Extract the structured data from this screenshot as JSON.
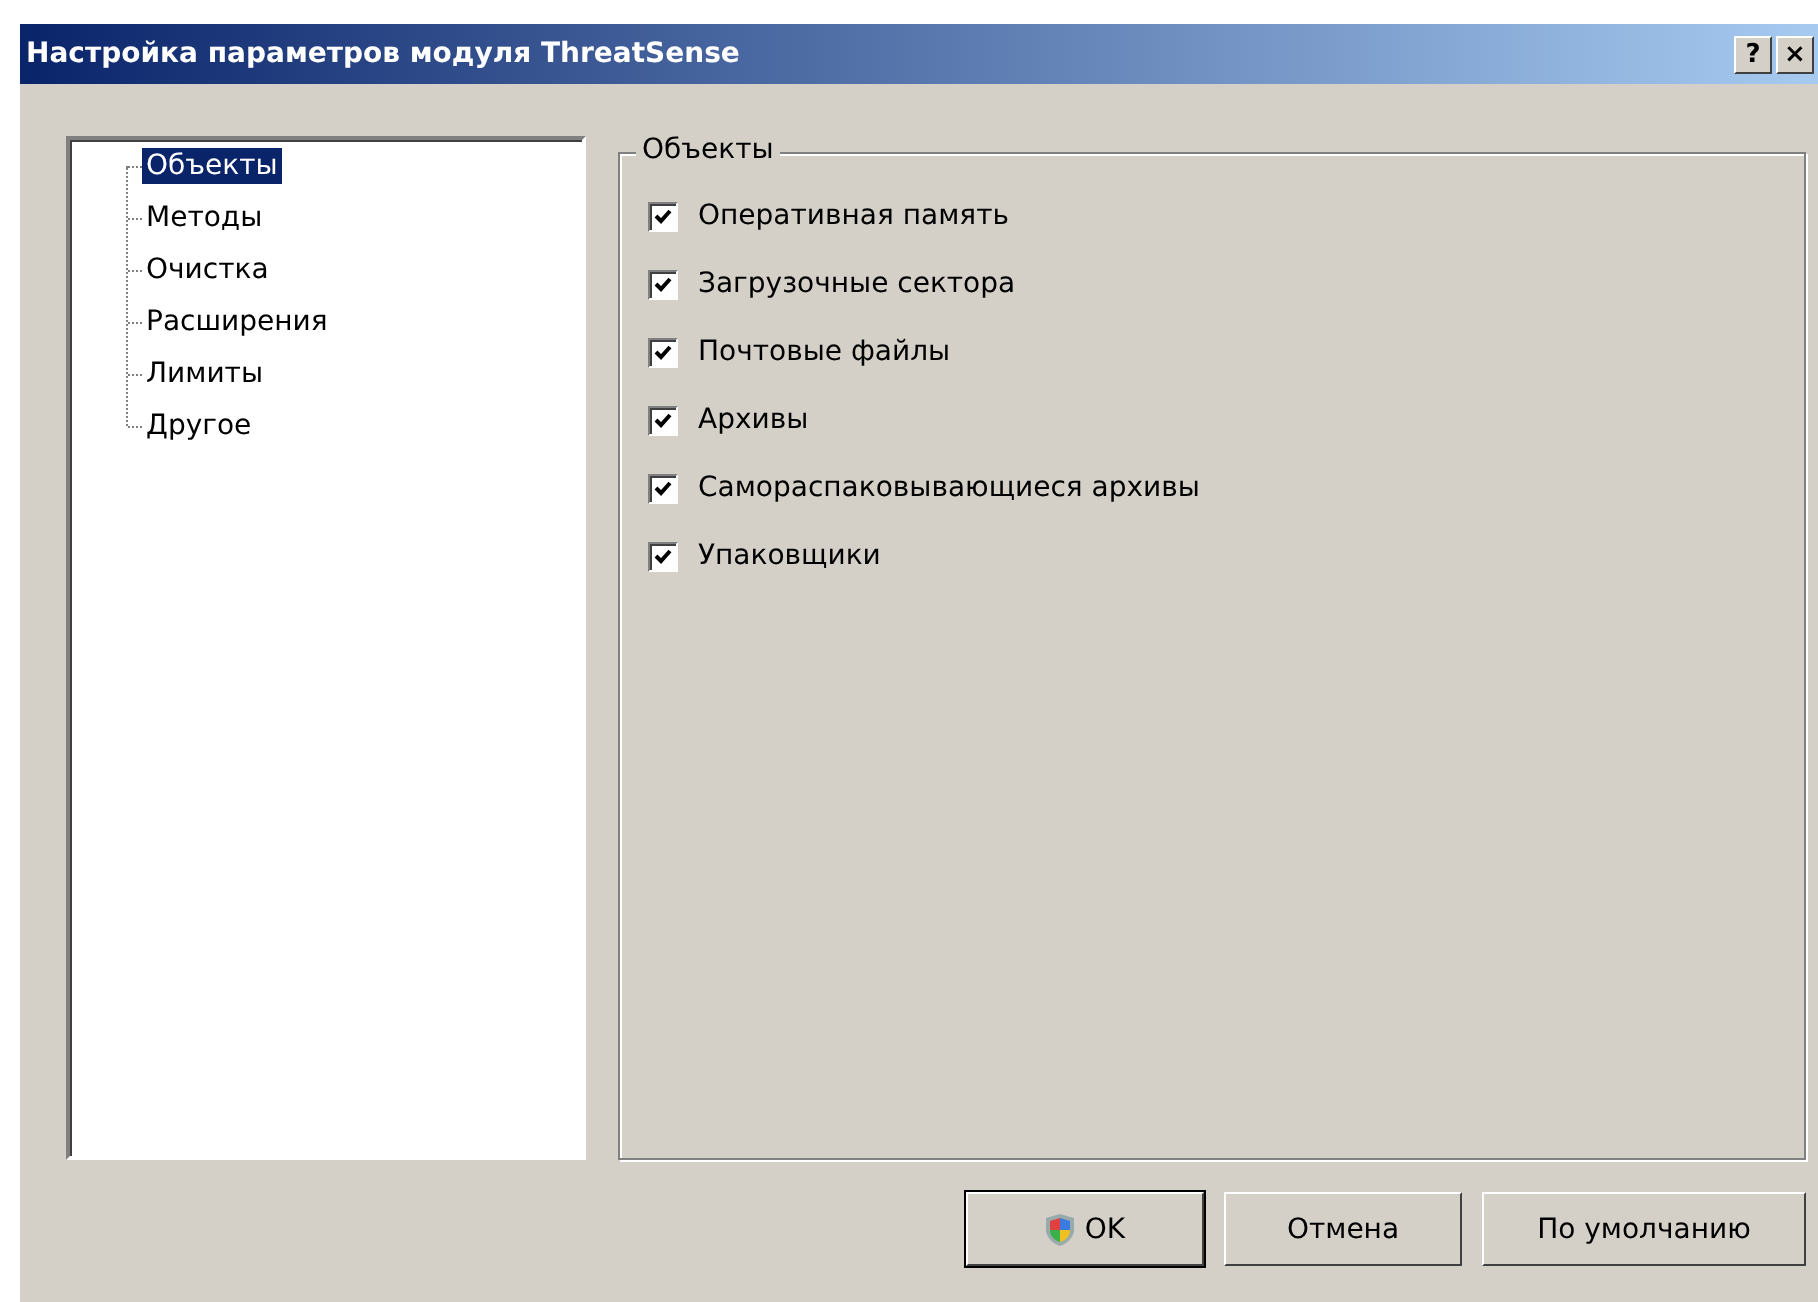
{
  "window": {
    "title": "Настройка параметров модуля ThreatSense",
    "title_buttons": [
      "?",
      "×"
    ]
  },
  "tree": {
    "items": [
      {
        "label": "Объекты",
        "selected": true
      },
      {
        "label": "Методы",
        "selected": false
      },
      {
        "label": "Очистка",
        "selected": false
      },
      {
        "label": "Расширения",
        "selected": false
      },
      {
        "label": "Лимиты",
        "selected": false
      },
      {
        "label": "Другое",
        "selected": false
      }
    ]
  },
  "group": {
    "title": "Объекты",
    "options": [
      {
        "label": "Оперативная память",
        "checked": true
      },
      {
        "label": "Загрузочные сектора",
        "checked": true
      },
      {
        "label": "Почтовые файлы",
        "checked": true
      },
      {
        "label": "Архивы",
        "checked": true
      },
      {
        "label": "Самораспаковывающиеся архивы",
        "checked": true
      },
      {
        "label": "Упаковщики",
        "checked": true
      }
    ]
  },
  "buttons": [
    {
      "label": "OK",
      "kind": "shield",
      "default": true
    },
    {
      "label": "Отмена",
      "kind": "plain",
      "default": false
    },
    {
      "label": "По умолчанию",
      "kind": "plain",
      "default": false
    }
  ]
}
